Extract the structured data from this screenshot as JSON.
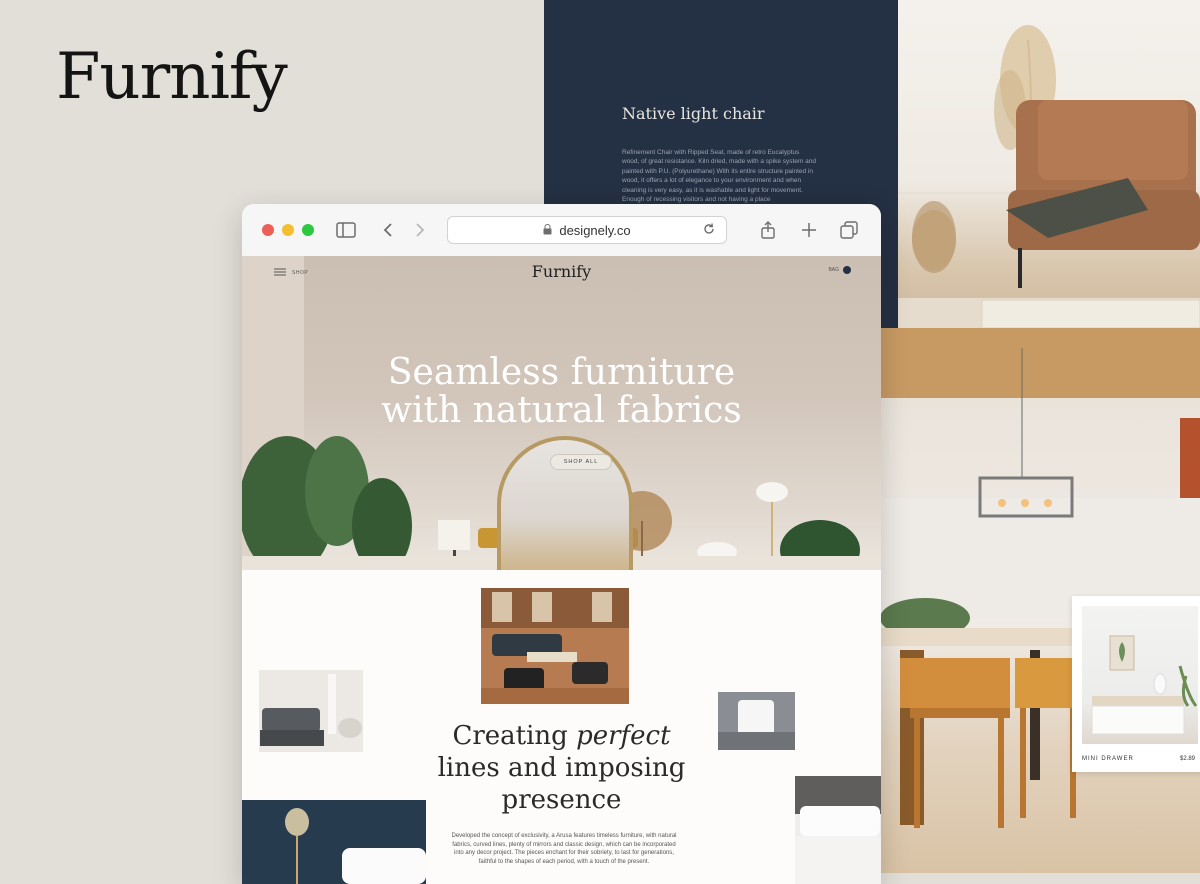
{
  "brand": {
    "logo": "Furnify"
  },
  "product_panel": {
    "title": "Native light chair",
    "description": "Refinement Chair with Ripped Seat, made of retro Eucalyptus wood, of great resistance. Kiln dried, made with a spike system and painted with P.U. (Polyurethane) With its entire structure painted in wood, it offers a lot of elegance to your environment and when cleaning is very easy, as it is washable and light for movement. Enough of recessing visitors and not having a place"
  },
  "product_card": {
    "name": "MINI DRAWER",
    "price": "$2.89"
  },
  "browser": {
    "url": "designely.co",
    "traffic_colors": {
      "close": "#ec5f57",
      "minimize": "#f3bf2f",
      "zoom": "#2bc840"
    }
  },
  "site": {
    "nav": {
      "shop": "SHOP",
      "logo": "Furnify",
      "bag": "BAG"
    },
    "hero": {
      "line1": "Seamless furniture",
      "line2": "with natural fabrics",
      "cta": "SHOP ALL"
    },
    "section": {
      "headline_prefix": "Creating ",
      "headline_em": "perfect",
      "headline_line2": "lines and imposing",
      "headline_line3": "presence",
      "body": "Developed the concept of exclusivity, a Arusa features timeless furniture, with natural fabrics, curved lines, plenty of mirrors and classic design, which can be incorporated into any decor project. The pieces enchant for their sobriety, to last for generations, faithful to the shapes of each period, with a touch of the present."
    }
  },
  "colors": {
    "navy": "#243043",
    "page_bg": "#e2dfd8"
  }
}
